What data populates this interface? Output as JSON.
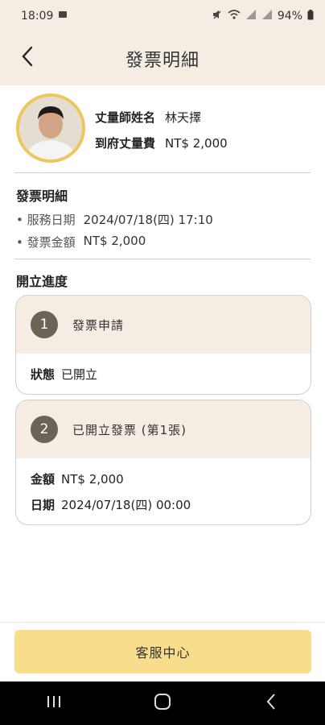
{
  "status_bar": {
    "time": "18:09",
    "battery": "94%"
  },
  "header": {
    "title": "發票明細"
  },
  "profile": {
    "name_label": "丈量師姓名",
    "name_value": "林天擇",
    "fee_label": "到府丈量費",
    "fee_value": "NT$ 2,000"
  },
  "invoice_details": {
    "title": "發票明細",
    "items": [
      {
        "label": "• 服務日期",
        "value": "2024/07/18(四) 17:10"
      },
      {
        "label": "• 發票金額",
        "value": "NT$ 2,000"
      }
    ]
  },
  "progress": {
    "title": "開立進度",
    "cards": [
      {
        "step": "1",
        "title": "發票申請",
        "rows": [
          {
            "label": "狀態",
            "value": "已開立"
          }
        ]
      },
      {
        "step": "2",
        "title": "已開立發票 (第1張)",
        "rows": [
          {
            "label": "金額",
            "value": "NT$ 2,000"
          },
          {
            "label": "日期",
            "value": "2024/07/18(四) 00:00"
          }
        ]
      }
    ]
  },
  "cta": {
    "label": "客服中心"
  },
  "colors": {
    "header_bg": "#f5ede3",
    "step_circle": "#6b6356",
    "cta_bg": "#f8dd8d",
    "avatar_ring": "#efc55e"
  },
  "icons": {
    "back": "chevron-left-icon",
    "nav_recent": "recent-apps-icon",
    "nav_home": "home-icon",
    "nav_back": "nav-back-icon"
  }
}
